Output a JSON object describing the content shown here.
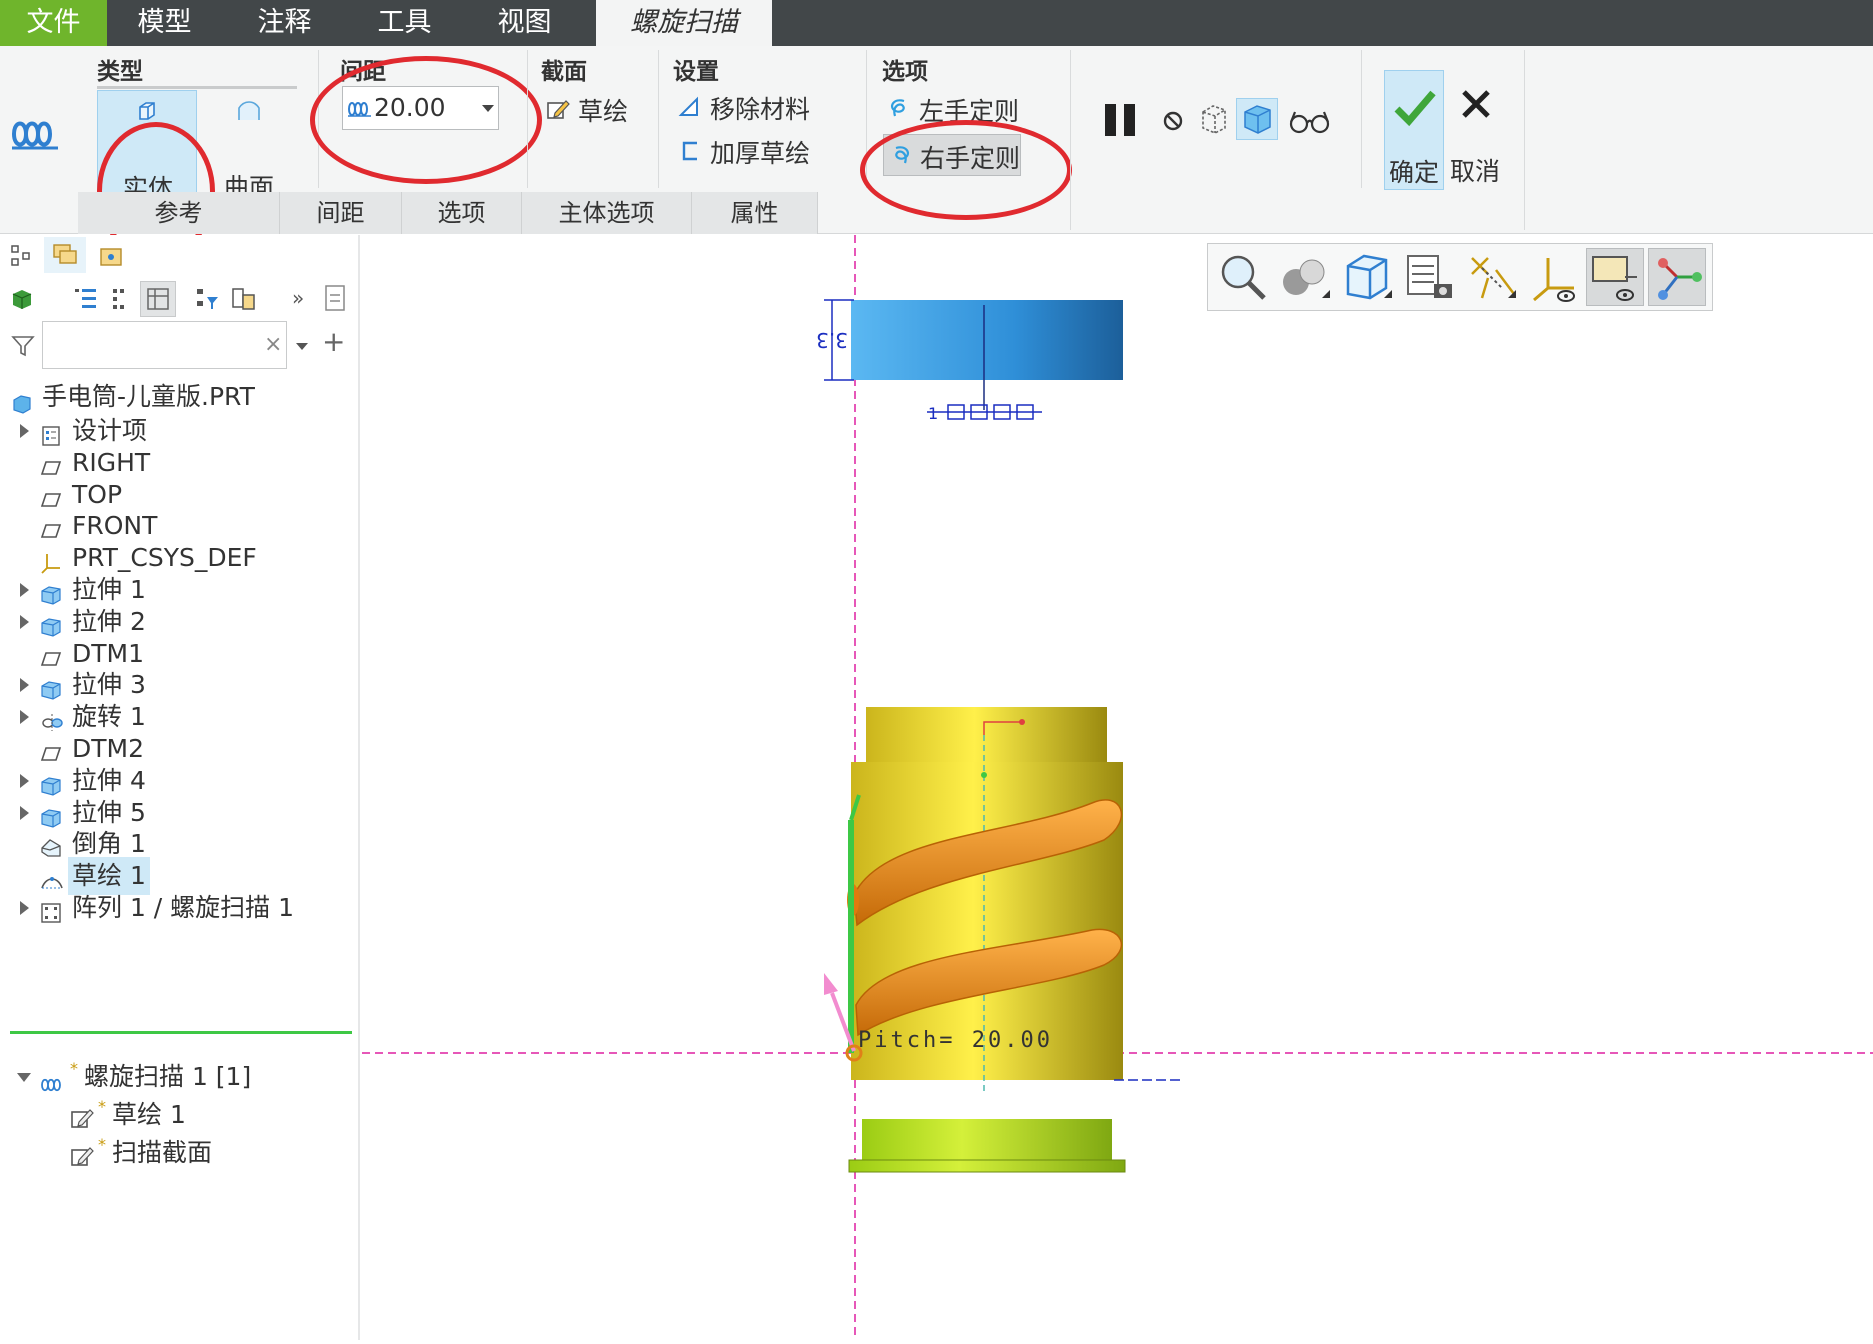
{
  "menubar": {
    "file": "文件",
    "model": "模型",
    "annotate": "注释",
    "tools": "工具",
    "view": "视图",
    "active_tab": "螺旋扫描"
  },
  "ribbon": {
    "type_group": {
      "title": "类型",
      "solid": "实体",
      "surface": "曲面"
    },
    "pitch_group": {
      "title": "间距",
      "value": "20.00"
    },
    "section_group": {
      "title": "截面",
      "sketch": "草绘"
    },
    "settings_group": {
      "title": "设置",
      "remove_material": "移除材料",
      "thicken_sketch": "加厚草绘"
    },
    "options_group": {
      "title": "选项",
      "left_hand": "左手定则",
      "right_hand": "右手定则"
    },
    "confirm": "确定",
    "cancel": "取消",
    "tabs": [
      "参考",
      "间距",
      "选项",
      "主体选项",
      "属性"
    ]
  },
  "tree": {
    "search_placeholder": "",
    "root": "手电筒-儿童版.PRT",
    "items": [
      {
        "label": "设计项",
        "icon": "design-items-icon",
        "expandable": true
      },
      {
        "label": "RIGHT",
        "icon": "datum-plane-icon",
        "expandable": false
      },
      {
        "label": "TOP",
        "icon": "datum-plane-icon",
        "expandable": false
      },
      {
        "label": "FRONT",
        "icon": "datum-plane-icon",
        "expandable": false
      },
      {
        "label": "PRT_CSYS_DEF",
        "icon": "csys-icon",
        "expandable": false
      },
      {
        "label": "拉伸 1",
        "icon": "extrude-icon",
        "expandable": true
      },
      {
        "label": "拉伸 2",
        "icon": "extrude-icon",
        "expandable": true
      },
      {
        "label": "DTM1",
        "icon": "datum-plane-icon",
        "expandable": false
      },
      {
        "label": "拉伸 3",
        "icon": "extrude-icon",
        "expandable": true
      },
      {
        "label": "旋转 1",
        "icon": "revolve-icon",
        "expandable": true
      },
      {
        "label": "DTM2",
        "icon": "datum-plane-icon",
        "expandable": false
      },
      {
        "label": "拉伸 4",
        "icon": "extrude-icon",
        "expandable": true
      },
      {
        "label": "拉伸 5",
        "icon": "extrude-icon",
        "expandable": true
      },
      {
        "label": "倒角 1",
        "icon": "chamfer-icon",
        "expandable": false
      },
      {
        "label": "草绘 1",
        "icon": "sketch-icon",
        "expandable": false,
        "selected": true
      },
      {
        "label": "阵列 1 / 螺旋扫描 1",
        "icon": "pattern-icon",
        "expandable": true
      }
    ],
    "active_feature": {
      "label": "螺旋扫描 1 [1]",
      "children": [
        {
          "label": "草绘 1"
        },
        {
          "label": "扫描截面"
        }
      ]
    }
  },
  "viewport": {
    "pitch_annotation": "Pitch= 20.00",
    "dimension_label": "3.3",
    "colors": {
      "helix": "#f08a16",
      "body": "#f2e22a",
      "cap": "#3a9be6",
      "base": "#b8e01e",
      "datum": "#e657b8"
    }
  },
  "colors": {
    "menubar": "#424749",
    "file_tab": "#6fb52c",
    "highlight": "#cfe9f7",
    "annotation_ring": "#e02a2f"
  }
}
